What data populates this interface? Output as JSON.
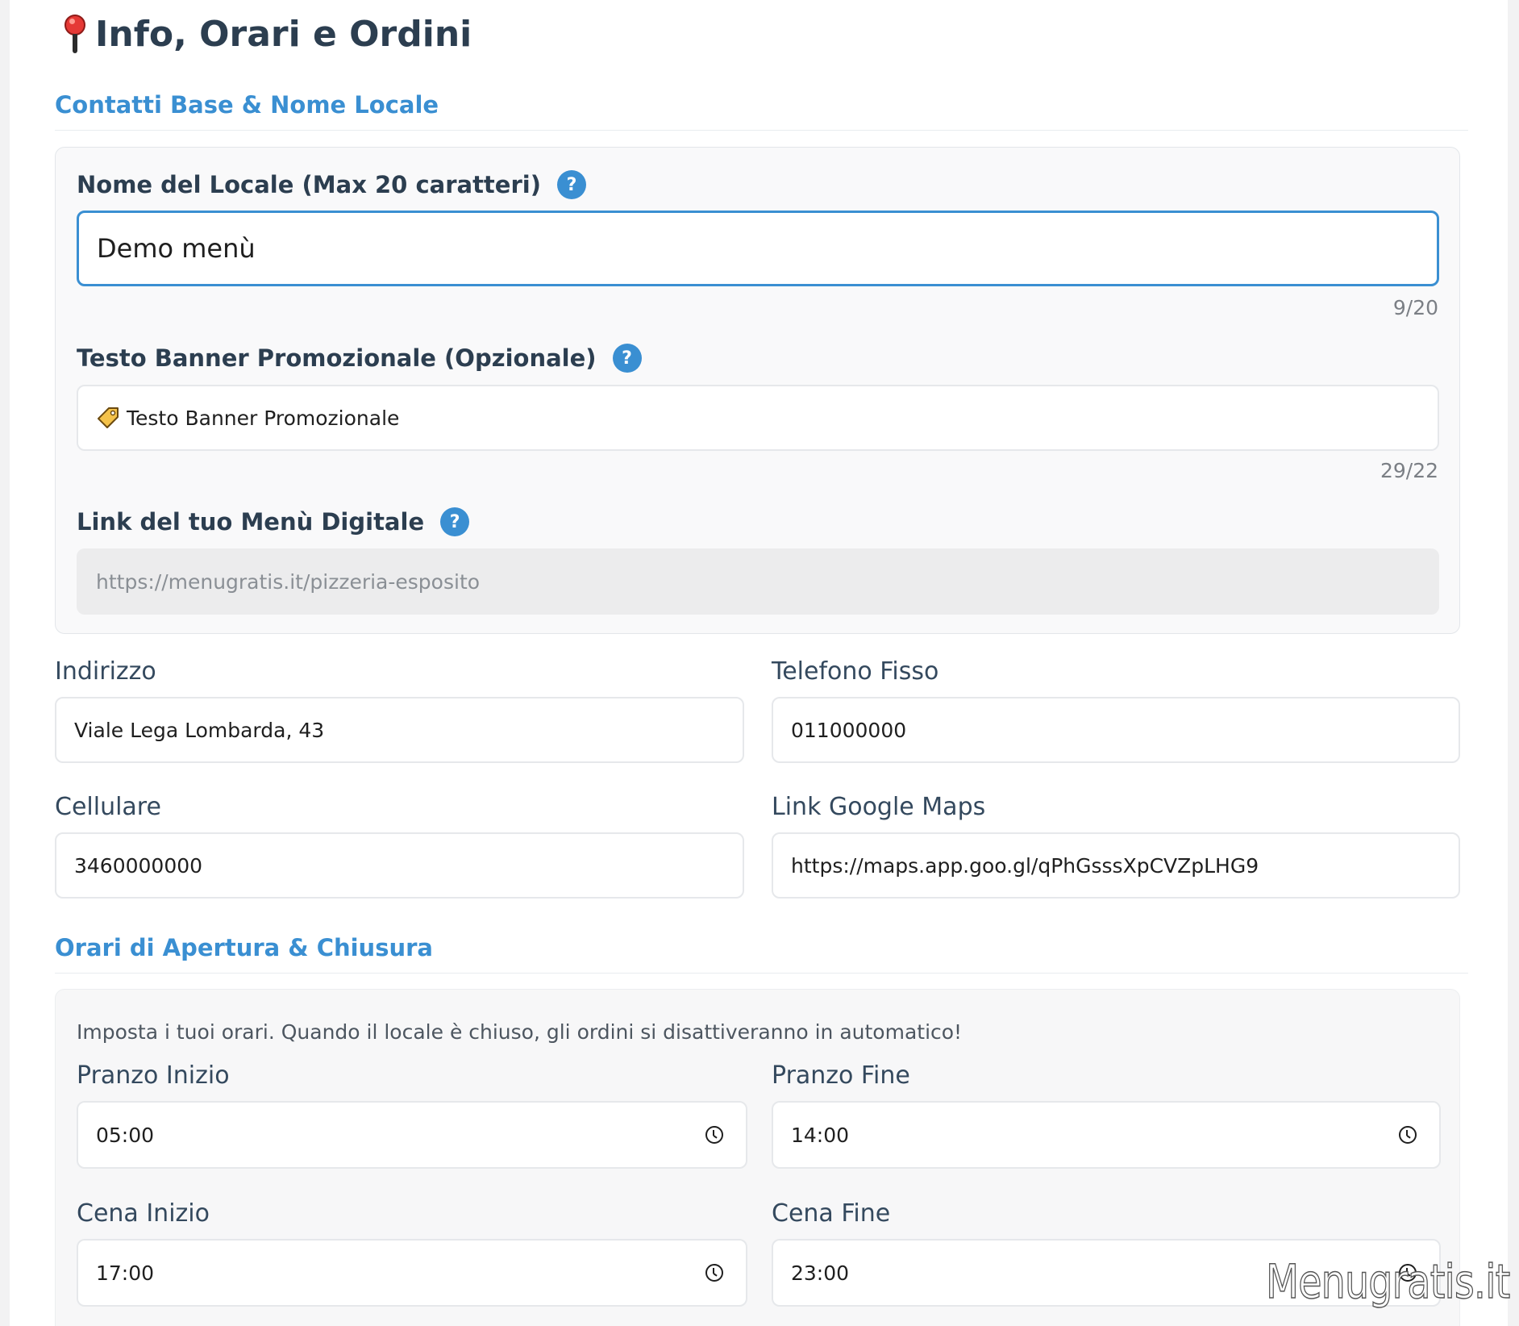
{
  "page": {
    "title": "Info, Orari e Ordini"
  },
  "contacts_section": {
    "title": "Contatti Base & Nome Locale"
  },
  "name_field": {
    "label": "Nome del Locale (Max 20 caratteri)",
    "value": "Demo menù",
    "counter": "9/20"
  },
  "banner_field": {
    "label": "Testo Banner Promozionale (Opzionale)",
    "value": "Testo Banner Promozionale",
    "counter": "29/22"
  },
  "menu_link_field": {
    "label": "Link del tuo Menù Digitale",
    "value": "https://menugratis.it/pizzeria-esposito"
  },
  "address_field": {
    "label": "Indirizzo",
    "value": "Viale Lega Lombarda, 43"
  },
  "phone_field": {
    "label": "Telefono Fisso",
    "value": "011000000"
  },
  "mobile_field": {
    "label": "Cellulare",
    "value": "3460000000"
  },
  "maps_field": {
    "label": "Link Google Maps",
    "value": "https://maps.app.goo.gl/qPhGsssXpCVZpLHG9"
  },
  "hours_section": {
    "title": "Orari di Apertura & Chiusura",
    "note": "Imposta i tuoi orari. Quando il locale è chiuso, gli ordini si disattiveranno in automatico!"
  },
  "lunch_start": {
    "label": "Pranzo Inizio",
    "value": "05:00"
  },
  "lunch_end": {
    "label": "Pranzo Fine",
    "value": "14:00"
  },
  "dinner_start": {
    "label": "Cena Inizio",
    "value": "17:00"
  },
  "dinner_end": {
    "label": "Cena Fine",
    "value": "23:00"
  },
  "watermark": {
    "text": "Menugratis.it"
  },
  "icons": {
    "title": "pin-icon",
    "help": "help-icon",
    "banner": "tag-icon",
    "time": "clock-icon"
  },
  "colors": {
    "accent": "#3a8fd2",
    "title_text": "#2c3e50",
    "pin_red": "#e53935"
  }
}
